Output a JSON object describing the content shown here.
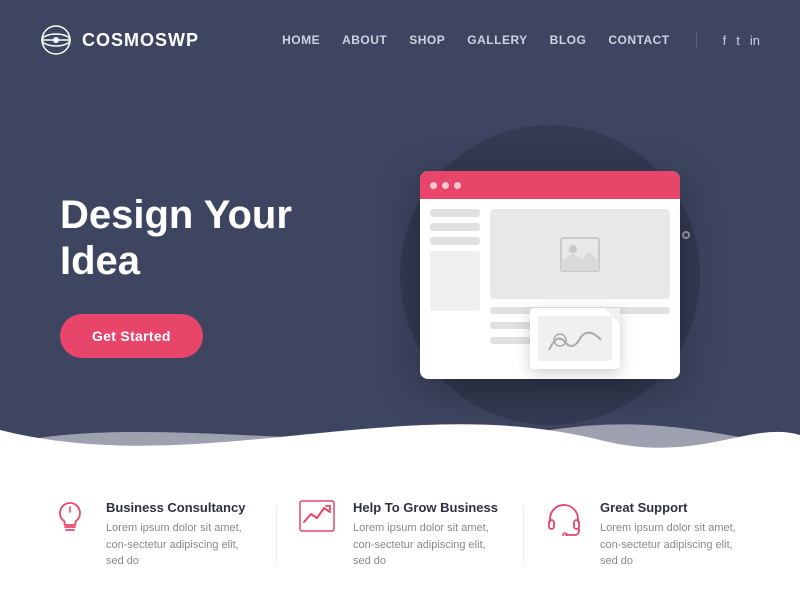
{
  "brand": {
    "name": "COSMOSWP",
    "logo_alt": "CosmoWP logo"
  },
  "nav": {
    "links": [
      {
        "label": "HOME",
        "id": "home"
      },
      {
        "label": "ABOUT",
        "id": "about"
      },
      {
        "label": "SHOP",
        "id": "shop"
      },
      {
        "label": "GALLERY",
        "id": "gallery"
      },
      {
        "label": "BLOG",
        "id": "blog"
      },
      {
        "label": "CONTACT",
        "id": "contact"
      }
    ],
    "social": [
      {
        "label": "f",
        "id": "facebook"
      },
      {
        "label": "t",
        "id": "twitter"
      },
      {
        "label": "in",
        "id": "linkedin"
      }
    ]
  },
  "hero": {
    "title_line1": "Design Your",
    "title_line2": "Idea",
    "cta_label": "Get Started"
  },
  "features": [
    {
      "id": "business",
      "title": "Business Consultancy",
      "desc": "Lorem ipsum dolor sit amet, con-sectetur adipiscing elit, sed do"
    },
    {
      "id": "grow",
      "title": "Help To Grow Business",
      "desc": "Lorem ipsum dolor sit amet, con-sectetur adipiscing elit, sed do"
    },
    {
      "id": "support",
      "title": "Great Support",
      "desc": "Lorem ipsum dolor sit amet, con-sectetur adipiscing elit, sed do"
    }
  ],
  "colors": {
    "hero_bg": "#3d4560",
    "accent": "#e8456a",
    "text_dark": "#2d3142"
  }
}
